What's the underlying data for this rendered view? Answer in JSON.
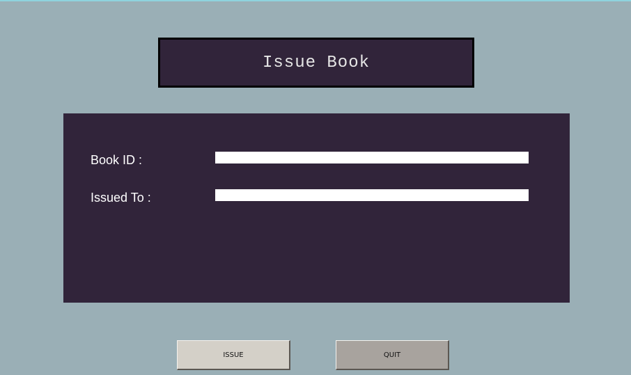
{
  "window": {
    "title": "Issue Book"
  },
  "form": {
    "book_id_label": "Book ID :",
    "book_id_value": "",
    "issued_to_label": "Issued To :",
    "issued_to_value": ""
  },
  "buttons": {
    "issue_label": "ISSUE",
    "quit_label": "QUIT"
  },
  "colors": {
    "background": "#9aafb6",
    "panel": "#31243a",
    "title_text": "#e6e6e6",
    "label_text": "#ffffff",
    "issue_button": "#d4d0c8",
    "quit_button": "#a8a39e"
  }
}
